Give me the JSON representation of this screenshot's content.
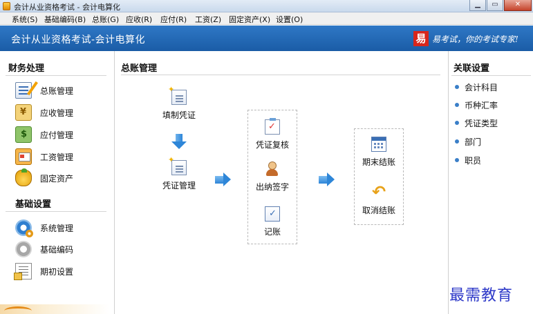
{
  "window": {
    "title": "会计从业资格考试 - 会计电算化"
  },
  "menu": [
    "系统(S)",
    "基础编码(B)",
    "总账(G)",
    "应收(R)",
    "应付(R)",
    "工资(Z)",
    "固定资产(X)",
    "设置(O)"
  ],
  "banner": {
    "title": "会计从业资格考试-会计电算化",
    "logo_char": "易",
    "slogan": "易考试，你的考试专家!"
  },
  "left": {
    "finance_title": "财务处理",
    "finance_items": [
      {
        "label": "总账管理",
        "icon": "ledger-icon"
      },
      {
        "label": "应收管理",
        "icon": "receivable-icon"
      },
      {
        "label": "应付管理",
        "icon": "payable-icon"
      },
      {
        "label": "工资管理",
        "icon": "wage-icon"
      },
      {
        "label": "固定资产",
        "icon": "fixed-asset-icon"
      }
    ],
    "basic_title": "基础设置",
    "basic_items": [
      {
        "label": "系统管理",
        "icon": "gears-icon"
      },
      {
        "label": "基础编码",
        "icon": "gear-icon"
      },
      {
        "label": "期初设置",
        "icon": "opening-balance-icon"
      }
    ]
  },
  "center": {
    "title": "总账管理",
    "flow": {
      "fill_voucher": "填制凭证",
      "voucher_manage": "凭证管理",
      "voucher_review": "凭证复核",
      "cashier_sign": "出纳签字",
      "bookkeeping": "记账",
      "period_close": "期末结账",
      "cancel_close": "取消结账"
    }
  },
  "right": {
    "title": "关联设置",
    "items": [
      "会计科目",
      "币种汇率",
      "凭证类型",
      "部门",
      "职员"
    ]
  },
  "watermark": "最需教育",
  "colors": {
    "banner": "#1f64ae",
    "arrow": "#2e86d8",
    "logo": "#d8261c"
  }
}
